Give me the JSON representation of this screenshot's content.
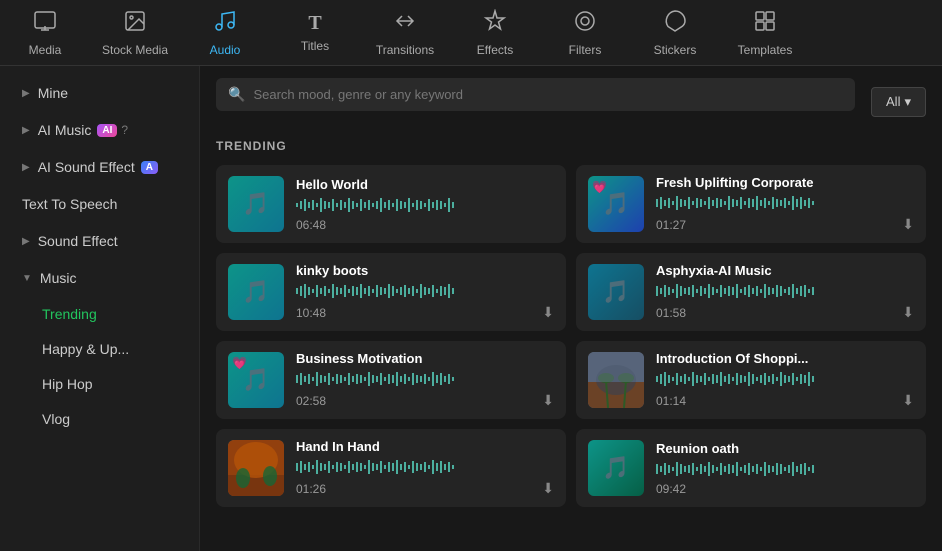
{
  "nav": {
    "items": [
      {
        "id": "media",
        "label": "Media",
        "icon": "🎞",
        "active": false
      },
      {
        "id": "stock-media",
        "label": "Stock Media",
        "icon": "📷",
        "active": false
      },
      {
        "id": "audio",
        "label": "Audio",
        "icon": "🎵",
        "active": true
      },
      {
        "id": "titles",
        "label": "Titles",
        "icon": "T",
        "active": false
      },
      {
        "id": "transitions",
        "label": "Transitions",
        "icon": "↔",
        "active": false
      },
      {
        "id": "effects",
        "label": "Effects",
        "icon": "✦",
        "active": false
      },
      {
        "id": "filters",
        "label": "Filters",
        "icon": "🔘",
        "active": false
      },
      {
        "id": "stickers",
        "label": "Stickers",
        "icon": "🏷",
        "active": false
      },
      {
        "id": "templates",
        "label": "Templates",
        "icon": "⊞",
        "active": false
      }
    ]
  },
  "sidebar": {
    "items": [
      {
        "id": "mine",
        "label": "Mine",
        "type": "expandable",
        "arrow": "▶"
      },
      {
        "id": "ai-music",
        "label": "AI Music",
        "type": "expandable",
        "arrow": "▶",
        "badge": "AI"
      },
      {
        "id": "ai-sound-effect",
        "label": "AI Sound Effect",
        "type": "expandable",
        "arrow": "▶",
        "badge": "A"
      },
      {
        "id": "text-to-speech",
        "label": "Text To Speech",
        "type": "plain"
      },
      {
        "id": "sound-effect",
        "label": "Sound Effect",
        "type": "expandable",
        "arrow": "▶"
      },
      {
        "id": "music",
        "label": "Music",
        "type": "expandable-open",
        "arrow": "▼"
      }
    ],
    "sub_items": [
      {
        "id": "trending",
        "label": "Trending",
        "active": true
      },
      {
        "id": "happy-up",
        "label": "Happy & Up...",
        "active": false
      },
      {
        "id": "hip-hop",
        "label": "Hip Hop",
        "active": false
      },
      {
        "id": "vlog",
        "label": "Vlog",
        "active": false
      }
    ]
  },
  "search": {
    "placeholder": "Search mood, genre or any keyword"
  },
  "filter": {
    "label": "All",
    "arrow": "▾"
  },
  "trending": {
    "section_title": "TRENDING",
    "cards": [
      {
        "id": "hello-world",
        "title": "Hello World",
        "duration": "06:48",
        "thumb_type": "teal",
        "has_heart": false
      },
      {
        "id": "fresh-uplifting",
        "title": "Fresh Uplifting Corporate",
        "duration": "01:27",
        "thumb_type": "teal",
        "has_heart": true
      },
      {
        "id": "kinky-boots",
        "title": "kinky boots",
        "duration": "10:48",
        "thumb_type": "teal",
        "has_heart": false
      },
      {
        "id": "asphyxia-ai-music",
        "title": "Asphyxia-AI Music",
        "duration": "01:58",
        "thumb_type": "teal",
        "has_heart": false
      },
      {
        "id": "business-motivation",
        "title": "Business Motivation",
        "duration": "02:58",
        "thumb_type": "teal",
        "has_heart": true
      },
      {
        "id": "intro-shopping",
        "title": "Introduction Of Shoppi...",
        "duration": "01:14",
        "thumb_type": "photo",
        "has_heart": false
      },
      {
        "id": "hand-in-hand",
        "title": "Hand In Hand",
        "duration": "01:26",
        "thumb_type": "photo2",
        "has_heart": true
      },
      {
        "id": "reunion-oath",
        "title": "Reunion oath",
        "duration": "09:42",
        "thumb_type": "teal2",
        "has_heart": false
      }
    ]
  }
}
